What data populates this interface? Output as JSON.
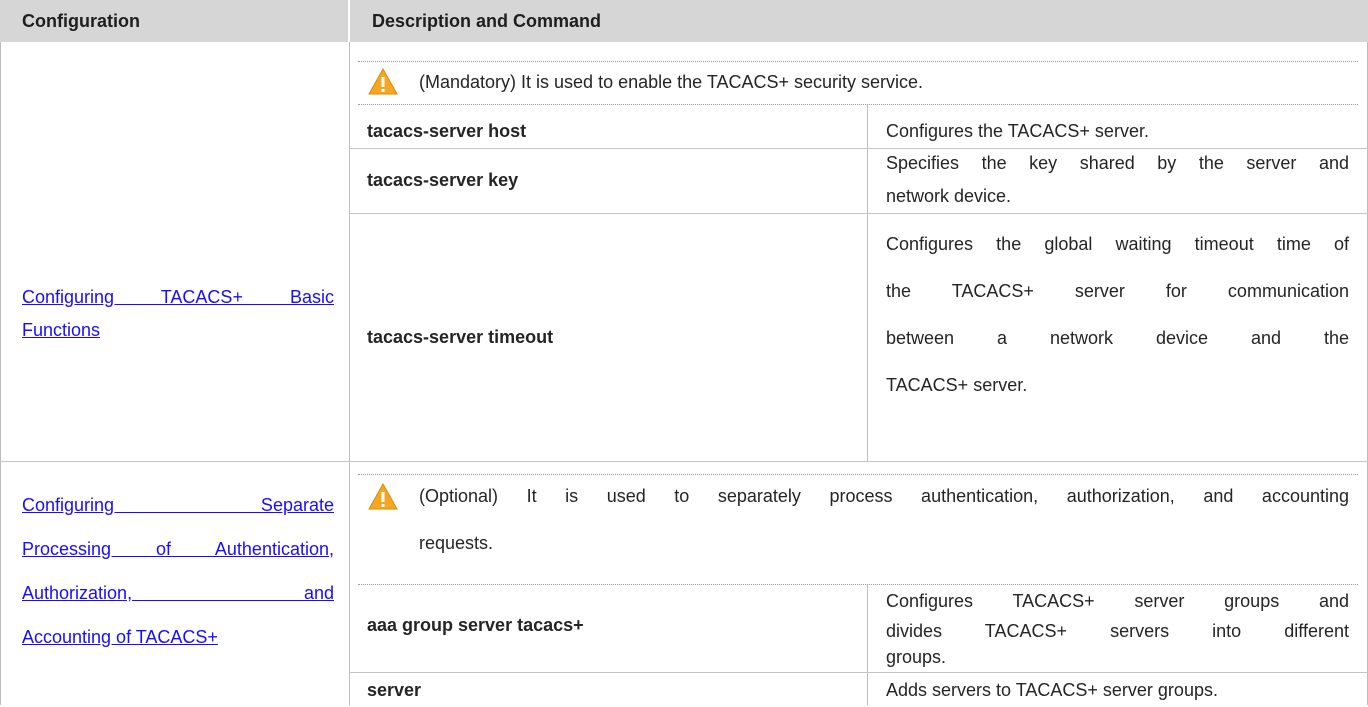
{
  "header": {
    "col1": "Configuration",
    "col2": "Description and Command"
  },
  "sections": [
    {
      "config_link": "Configuring TACACS+ Basic Functions",
      "link_lines": [
        "Configuring TACACS+ Basic",
        "Functions"
      ],
      "note": "(Mandatory) It is used to enable the TACACS+ security service.",
      "note_icon": "warning-icon",
      "rows": [
        {
          "command": "tacacs-server host",
          "description_lines": [
            "Configures the TACACS+ server."
          ]
        },
        {
          "command": "tacacs-server key",
          "description_lines": [
            "Specifies the key shared by the server and",
            "network device."
          ]
        },
        {
          "command": "tacacs-server timeout",
          "description_lines": [
            "Configures the global waiting timeout time of",
            "the TACACS+ server for communication",
            "between a network device and the",
            "TACACS+ server."
          ]
        }
      ]
    },
    {
      "config_link": "Configuring Separate Processing of Authentication, Authorization, and Accounting of TACACS+",
      "link_lines": [
        "Configuring Separate",
        "Processing of Authentication,",
        "Authorization, and",
        "Accounting of TACACS+"
      ],
      "note_lines": [
        "(Optional) It is used to separately process authentication, authorization, and accounting",
        "requests."
      ],
      "note_icon": "warning-icon",
      "rows": [
        {
          "command": "aaa group server tacacs+",
          "description_lines": [
            "Configures TACACS+ server groups and",
            "divides TACACS+ servers into different",
            "groups."
          ]
        },
        {
          "command": "server",
          "description_lines": [
            "Adds servers to TACACS+ server groups."
          ]
        }
      ]
    }
  ],
  "colors": {
    "header_bg": "#d6d6d6",
    "link": "#1a0dff",
    "warning": "#f5a623"
  }
}
